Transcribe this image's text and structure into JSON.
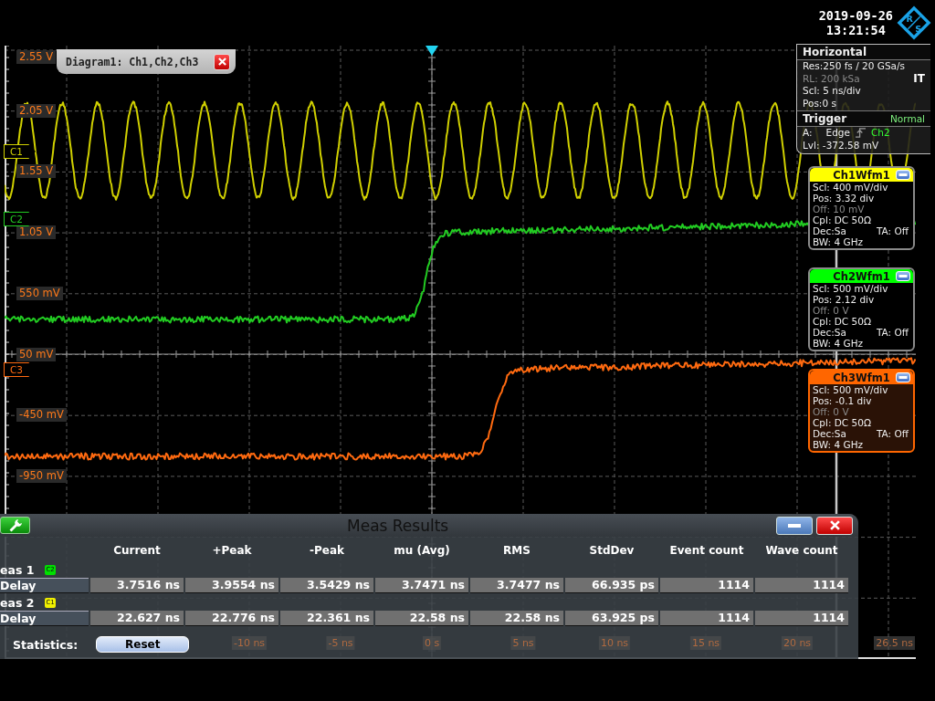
{
  "clock": {
    "date": "2019-09-26",
    "time": "13:21:54"
  },
  "logo": {
    "letters": [
      "R",
      "S"
    ]
  },
  "diagram": {
    "title": "Diagram1: Ch1,Ch2,Ch3",
    "y_labels": [
      "2.55 V",
      "2.05 V",
      "1.55 V",
      "1.05 V",
      "550 mV",
      "50 mV",
      "-450 mV",
      "-950 mV"
    ],
    "x_labels": [
      "-10 ns",
      "-5 ns",
      "0 s",
      "5 ns",
      "10 ns",
      "15 ns",
      "20 ns"
    ],
    "x_end_label": "26.5 ns",
    "traces": [
      {
        "marker": "C1",
        "color": "#d0d000",
        "kind": "sine"
      },
      {
        "marker": "C2",
        "color": "#22cc22",
        "kind": "step"
      },
      {
        "marker": "C3",
        "color": "#ff6a10",
        "kind": "step"
      }
    ]
  },
  "horizontal": {
    "title": "Horizontal",
    "rows": [
      {
        "text": "Res:250 fs / 20 GSa/s",
        "dimmed": false
      },
      {
        "text": "RL: 200 kSa",
        "dimmed": true,
        "badge": "IT"
      },
      {
        "text": "Scl: 5 ns/div",
        "dimmed": false
      },
      {
        "text": "Pos:0 s",
        "dimmed": false
      }
    ]
  },
  "trigger": {
    "title": "Trigger",
    "mode": "Normal",
    "source_label": "A:",
    "type": "Edge",
    "source": "Ch2",
    "level_text": "Lvl: -372.58 mV"
  },
  "channels": [
    {
      "title": "Ch1Wfm1",
      "color": "#ffff00",
      "selected": false,
      "rows": [
        {
          "text": "Scl: 400 mV/div",
          "dimmed": false
        },
        {
          "text": "Pos: 3.32 div",
          "dimmed": false
        },
        {
          "text": "Off: 10 mV",
          "dimmed": true
        },
        {
          "text": "Cpl: DC 50Ω",
          "dimmed": false
        },
        {
          "text": "Dec:Sa",
          "dimmed": false,
          "extra": "TA: Off"
        },
        {
          "text": "BW: 4 GHz",
          "dimmed": false
        }
      ]
    },
    {
      "title": "Ch2Wfm1",
      "color": "#00ff00",
      "selected": false,
      "rows": [
        {
          "text": "Scl: 500 mV/div",
          "dimmed": false
        },
        {
          "text": "Pos: 2.12 div",
          "dimmed": false
        },
        {
          "text": "Off: 0 V",
          "dimmed": true
        },
        {
          "text": "Cpl: DC 50Ω",
          "dimmed": false
        },
        {
          "text": "Dec:Sa",
          "dimmed": false,
          "extra": "TA: Off"
        },
        {
          "text": "BW: 4 GHz",
          "dimmed": false
        }
      ]
    },
    {
      "title": "Ch3Wfm1",
      "color": "#ff6600",
      "selected": true,
      "rows": [
        {
          "text": "Scl: 500 mV/div",
          "dimmed": false
        },
        {
          "text": "Pos: -0.1 div",
          "dimmed": false
        },
        {
          "text": "Off: 0 V",
          "dimmed": true
        },
        {
          "text": "Cpl: DC 50Ω",
          "dimmed": false
        },
        {
          "text": "Dec:Sa",
          "dimmed": false,
          "extra": "TA: Off"
        },
        {
          "text": "BW: 4 GHz",
          "dimmed": false
        }
      ]
    }
  ],
  "meas": {
    "title": "Meas Results",
    "columns": [
      "Current",
      "+Peak",
      "-Peak",
      "mu (Avg)",
      "RMS",
      "StdDev",
      "Event count",
      "Wave count"
    ],
    "groups": [
      {
        "label": "eas 1",
        "source": "C2",
        "color": "#00e000",
        "rows": [
          {
            "name": "Delay",
            "values": [
              "3.7516 ns",
              "3.9554 ns",
              "3.5429 ns",
              "3.7471 ns",
              "3.7477 ns",
              "66.935 ps",
              "1114",
              "1114"
            ]
          }
        ]
      },
      {
        "label": "eas 2",
        "source": "C1",
        "color": "#f0f000",
        "rows": [
          {
            "name": "Delay",
            "values": [
              "22.627 ns",
              "22.776 ns",
              "22.361 ns",
              "22.58 ns",
              "22.58 ns",
              "63.925 ps",
              "1114",
              "1114"
            ]
          }
        ]
      }
    ],
    "statistics_label": "Statistics:",
    "reset_button": "Reset"
  }
}
